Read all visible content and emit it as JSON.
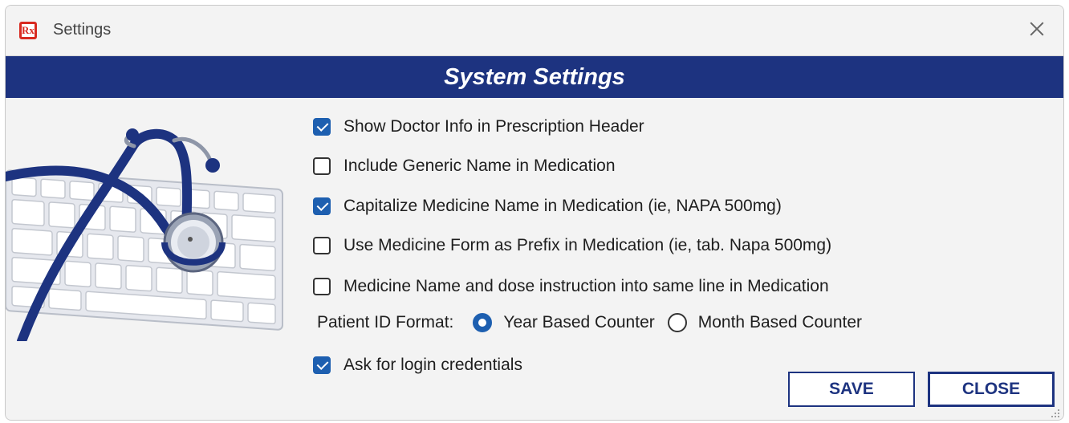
{
  "window": {
    "title": "Settings",
    "app_icon_text": "Rx"
  },
  "banner": {
    "title": "System Settings"
  },
  "options": [
    {
      "label": "Show Doctor Info in Prescription Header",
      "checked": true
    },
    {
      "label": "Include Generic Name in Medication",
      "checked": false
    },
    {
      "label": "Capitalize Medicine Name in Medication (ie, NAPA 500mg)",
      "checked": true
    },
    {
      "label": "Use Medicine Form as Prefix in Medication (ie, tab. Napa 500mg)",
      "checked": false
    },
    {
      "label": "Medicine Name and dose instruction into same line in Medication",
      "checked": false
    }
  ],
  "patient_id": {
    "label": "Patient ID Format:",
    "options": [
      {
        "label": "Year Based Counter",
        "selected": true
      },
      {
        "label": "Month Based Counter",
        "selected": false
      }
    ]
  },
  "login": {
    "label": "Ask for login credentials",
    "checked": true
  },
  "buttons": {
    "save": "SAVE",
    "close": "CLOSE"
  },
  "colors": {
    "banner": "#1d3380",
    "accent": "#1d5fb0",
    "app_icon": "#d82a20"
  },
  "icons": {
    "app": "rx-icon",
    "close": "close-icon"
  }
}
